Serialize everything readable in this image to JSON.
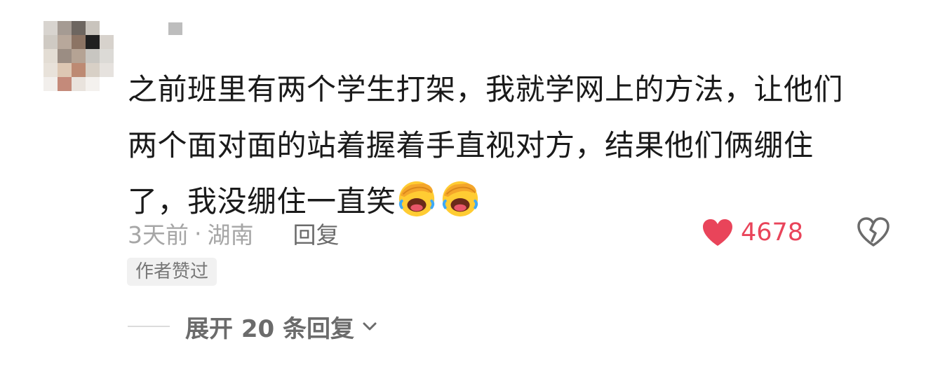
{
  "comment": {
    "text_line1": "之前班里有两个学生打架，我就学网上的方法，让他们",
    "text_line2": "两个面对面的站着握着手直视对方，结果他们俩绷住",
    "text_line3": "了，我没绷住一直笑",
    "emojis": [
      "facepalm-laugh-emoji",
      "facepalm-laugh-emoji"
    ],
    "time": "3天前",
    "separator": "·",
    "location": "湖南",
    "reply_label": "回复",
    "like_count": "4678",
    "author_badge": "作者赞过",
    "expand_label": "展开 20 条回复"
  },
  "colors": {
    "like": "#e9445a",
    "meta": "#a6a6a6",
    "text": "#1a1a1a"
  },
  "icons": {
    "like": "heart-icon",
    "dislike": "broken-heart-icon",
    "expand": "chevron-down-icon"
  }
}
